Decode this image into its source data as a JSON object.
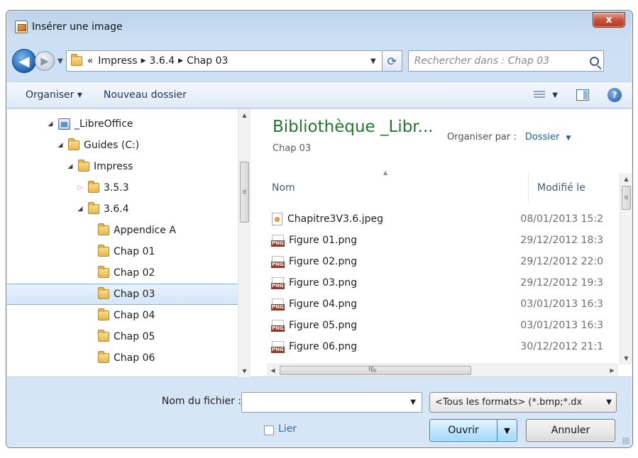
{
  "window": {
    "title": "Insérer une image",
    "close_label": "x"
  },
  "nav": {
    "back_glyph": "◀",
    "forward_glyph": "▶",
    "breadcrumb_overflow": "«",
    "breadcrumb": [
      "Impress",
      "3.6.4",
      "Chap 03"
    ],
    "refresh_glyph": "⟳",
    "search_placeholder": "Rechercher dans : Chap 03"
  },
  "toolbar": {
    "organize": "Organiser ▾",
    "new_folder": "Nouveau dossier",
    "help_glyph": "?"
  },
  "tree": {
    "items": [
      {
        "label": "_LibreOffice",
        "level": 0,
        "twisty": "◢",
        "icon": "library-icon"
      },
      {
        "label": "Guides (C:)",
        "level": 1,
        "twisty": "◢",
        "icon": "folder-icon"
      },
      {
        "label": "Impress",
        "level": 2,
        "twisty": "◢",
        "icon": "folder-icon"
      },
      {
        "label": "3.5.3",
        "level": 3,
        "twisty": "▷",
        "icon": "folder-icon"
      },
      {
        "label": "3.6.4",
        "level": 3,
        "twisty": "◢",
        "icon": "folder-icon"
      },
      {
        "label": "Appendice A",
        "level": 4,
        "twisty": "",
        "icon": "folder-icon"
      },
      {
        "label": "Chap 01",
        "level": 4,
        "twisty": "",
        "icon": "folder-icon"
      },
      {
        "label": "Chap 02",
        "level": 4,
        "twisty": "",
        "icon": "folder-icon"
      },
      {
        "label": "Chap 03",
        "level": 4,
        "twisty": "",
        "icon": "folder-icon",
        "selected": true
      },
      {
        "label": "Chap 04",
        "level": 4,
        "twisty": "",
        "icon": "folder-icon"
      },
      {
        "label": "Chap 05",
        "level": 4,
        "twisty": "",
        "icon": "folder-icon"
      },
      {
        "label": "Chap 06",
        "level": 4,
        "twisty": "",
        "icon": "folder-icon"
      }
    ]
  },
  "library": {
    "title": "Bibliothèque _Libr...",
    "subtitle": "Chap 03",
    "arrange_label": "Organiser par :",
    "arrange_value": "Dossier"
  },
  "files": {
    "columns": {
      "name": "Nom",
      "modified": "Modifié le"
    },
    "rows": [
      {
        "name": "Chapitre3V3.6.jpeg",
        "date": "08/01/2013 15:2",
        "type": "jpeg"
      },
      {
        "name": "Figure 01.png",
        "date": "29/12/2012 18:3",
        "type": "png"
      },
      {
        "name": "Figure 02.png",
        "date": "29/12/2012 22:0",
        "type": "png"
      },
      {
        "name": "Figure 03.png",
        "date": "29/12/2012 19:3",
        "type": "png"
      },
      {
        "name": "Figure 04.png",
        "date": "03/01/2013 16:3",
        "type": "png"
      },
      {
        "name": "Figure 05.png",
        "date": "03/01/2013 16:3",
        "type": "png"
      },
      {
        "name": "Figure 06.png",
        "date": "30/12/2012 21:1",
        "type": "png"
      }
    ],
    "hscroll_grip": "III"
  },
  "footer": {
    "filename_label": "Nom du fichier :",
    "filename_value": "",
    "filter": "<Tous les formats> (*.bmp;*.dx",
    "link_label": "Lier",
    "link_checked": false,
    "open_label": "Ouvrir",
    "cancel_label": "Annuler"
  }
}
